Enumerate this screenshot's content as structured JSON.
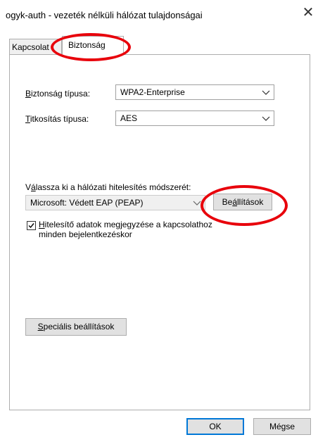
{
  "window": {
    "title": "ogyk-auth - vezeték nélküli hálózat tulajdonságai",
    "close_glyph": "✕"
  },
  "tabs": [
    {
      "label": "Kapcsolat",
      "active": false
    },
    {
      "label": "Biztonság",
      "active": true
    }
  ],
  "security": {
    "type_label_first": "B",
    "type_label_rest": "iztonság típusa:",
    "type_value": "WPA2-Enterprise",
    "encryption_label_first": "T",
    "encryption_label_rest": "itkosítás típusa:",
    "encryption_value": "AES"
  },
  "auth": {
    "prompt_pre": "V",
    "prompt_u": "á",
    "prompt_post": "lassza ki a hálózati hitelesítés módszerét:",
    "method_value": "Microsoft: Védett EAP (PEAP)",
    "settings_pre": "Be",
    "settings_u": "á",
    "settings_post": "llítások",
    "remember_checked": true,
    "remember_u": "H",
    "remember_line1_rest": "itelesítő adatok megjegyzése a kapcsolathoz",
    "remember_line2": "minden bejelentkezéskor"
  },
  "advanced": {
    "u": "S",
    "rest": "peciális beállítások"
  },
  "footer": {
    "ok_label": "OK",
    "cancel_label": "Mégse"
  },
  "colors": {
    "annotation": "#e8000b",
    "focus_border": "#0078d7"
  }
}
